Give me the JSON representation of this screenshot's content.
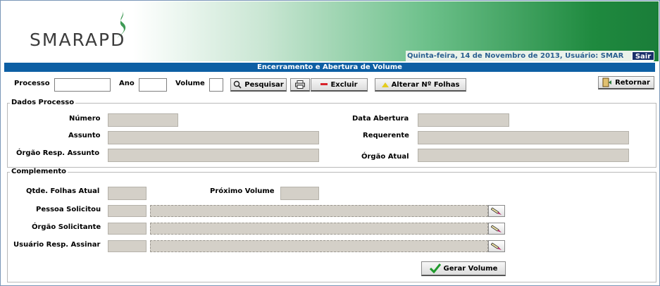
{
  "header": {
    "logo_text": "SMARAPD",
    "user_info": "Quinta-feira, 14 de Novembro de 2013, Usuário: SMAR",
    "logout_label": "Sair",
    "title": "Encerramento e Abertura de Volume"
  },
  "search": {
    "processo_label": "Processo",
    "processo_value": "",
    "ano_label": "Ano",
    "ano_value": "",
    "volume_label": "Volume",
    "volume_value": ""
  },
  "toolbar": {
    "pesquisar_label": "Pesquisar",
    "excluir_label": "Excluir",
    "alterar_label": "Alterar Nº Folhas",
    "retornar_label": "Retornar"
  },
  "dados_processo": {
    "legend": "Dados Processo",
    "numero_label": "Número",
    "assunto_label": "Assunto",
    "orgao_resp_label": "Órgão Resp. Assunto",
    "data_abertura_label": "Data Abertura",
    "requerente_label": "Requerente",
    "orgao_atual_label": "Órgão Atual"
  },
  "complemento": {
    "legend": "Complemento",
    "qtde_folhas_label": "Qtde. Folhas Atual",
    "proximo_volume_label": "Próximo Volume",
    "pessoa_label": "Pessoa Solicitou",
    "orgao_solicitante_label": "Órgão Solicitante",
    "usuario_label": "Usuário Resp. Assinar",
    "gerar_label": "Gerar Volume"
  },
  "colors": {
    "title_bar": "#0d5fa4",
    "brand_green": "#1a7d39",
    "readonly_field": "#d4d0c8"
  }
}
